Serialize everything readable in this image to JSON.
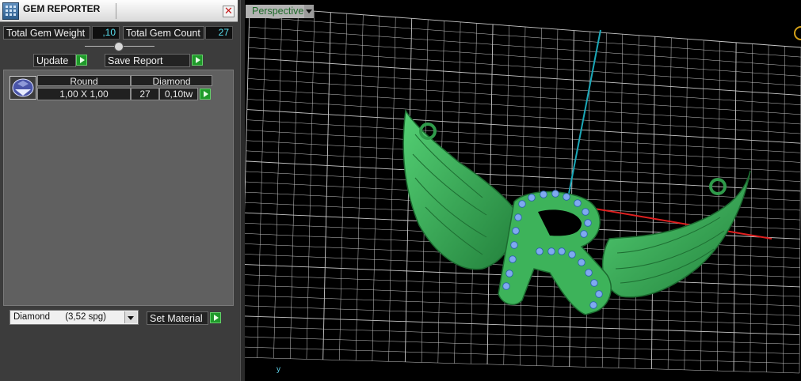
{
  "panel": {
    "title": "GEM REPORTER",
    "close_glyph": "✕",
    "total_weight_label": "Total Gem Weight",
    "total_weight_value": ",10",
    "total_count_label": "Total Gem Count",
    "total_count_value": "27",
    "update_label": "Update",
    "save_report_label": "Save Report"
  },
  "gem_table": {
    "columns": [
      "Round",
      "Diamond"
    ],
    "row": {
      "size": "1,00 X 1,00",
      "count": "27",
      "weight": "0,10tw"
    }
  },
  "material": {
    "selected": "Diamond      (3,52 spg)",
    "set_label": "Set Material"
  },
  "viewport": {
    "view_name": "Perspective",
    "axis_label": "y"
  },
  "colors": {
    "model_green": "#3db35a",
    "gem_blue": "#7fa9f0",
    "grid": "#c8c8c8",
    "axis_x": "#e02020",
    "axis_z": "#1aa8b8"
  }
}
